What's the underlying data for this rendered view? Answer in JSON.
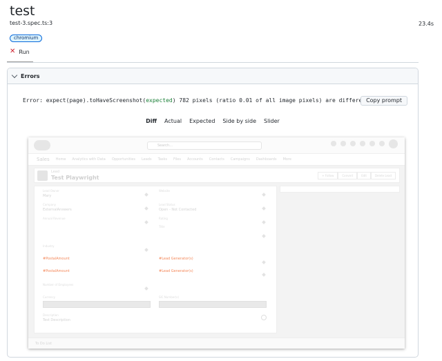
{
  "header": {
    "title": "test",
    "file": "test-3.spec.ts:3",
    "duration": "23.4s"
  },
  "badge": "chromium",
  "run_tab": {
    "icon": "close-icon",
    "label": "Run"
  },
  "errors": {
    "heading": "Errors",
    "message_prefix": "Error: expect(",
    "message_page": "page",
    "message_middle": ").toHaveScreenshot(",
    "message_expected": "expected",
    "message_suffix": ") 782 pixels (ratio 0.01 of all image pixels) are different.",
    "copy_button": "Copy prompt"
  },
  "diff_tabs": [
    {
      "label": "Diff",
      "active": true
    },
    {
      "label": "Actual",
      "active": false
    },
    {
      "label": "Expected",
      "active": false
    },
    {
      "label": "Side by side",
      "active": false
    },
    {
      "label": "Slider",
      "active": false
    }
  ],
  "screenshot": {
    "search_placeholder": "Search...",
    "app_name": "Sales",
    "nav_items": [
      "Home",
      "Analytics with Data",
      "Opportunities",
      "Leads",
      "Tasks",
      "Files",
      "Accounts",
      "Contacts",
      "Campaigns",
      "Dashboards",
      "More"
    ],
    "record_object": "Lead",
    "record_name": "Test Playwright",
    "record_buttons": [
      "+ Follow",
      "Convert",
      "Edit",
      "Delete Lead"
    ],
    "fields_left": [
      {
        "label": "Lead Owner",
        "value": "Mary"
      },
      {
        "label": "Company",
        "value": "ExternalAnswers"
      },
      {
        "label": "Annual Revenue",
        "value": ""
      },
      {
        "label": "Industry",
        "value": ""
      },
      {
        "label": "",
        "value": "#PostalAmount"
      },
      {
        "label": "",
        "value": "#PostalAmount"
      },
      {
        "label": "Number of Employees",
        "value": ""
      },
      {
        "label": "Currency",
        "value": ""
      },
      {
        "label": "Description",
        "value": "Test Description"
      }
    ],
    "fields_right": [
      {
        "label": "Website",
        "value": ""
      },
      {
        "label": "Lead Status",
        "value": "Open - Not Contacted"
      },
      {
        "label": "Rating",
        "value": ""
      },
      {
        "label": "Title",
        "value": ""
      },
      {
        "label": "",
        "value": "#Lead Generator(s)"
      },
      {
        "label": "",
        "value": "#Lead Generator(s)"
      },
      {
        "label": "SIC Number(s)",
        "value": ""
      }
    ],
    "footer": "To Do List"
  }
}
